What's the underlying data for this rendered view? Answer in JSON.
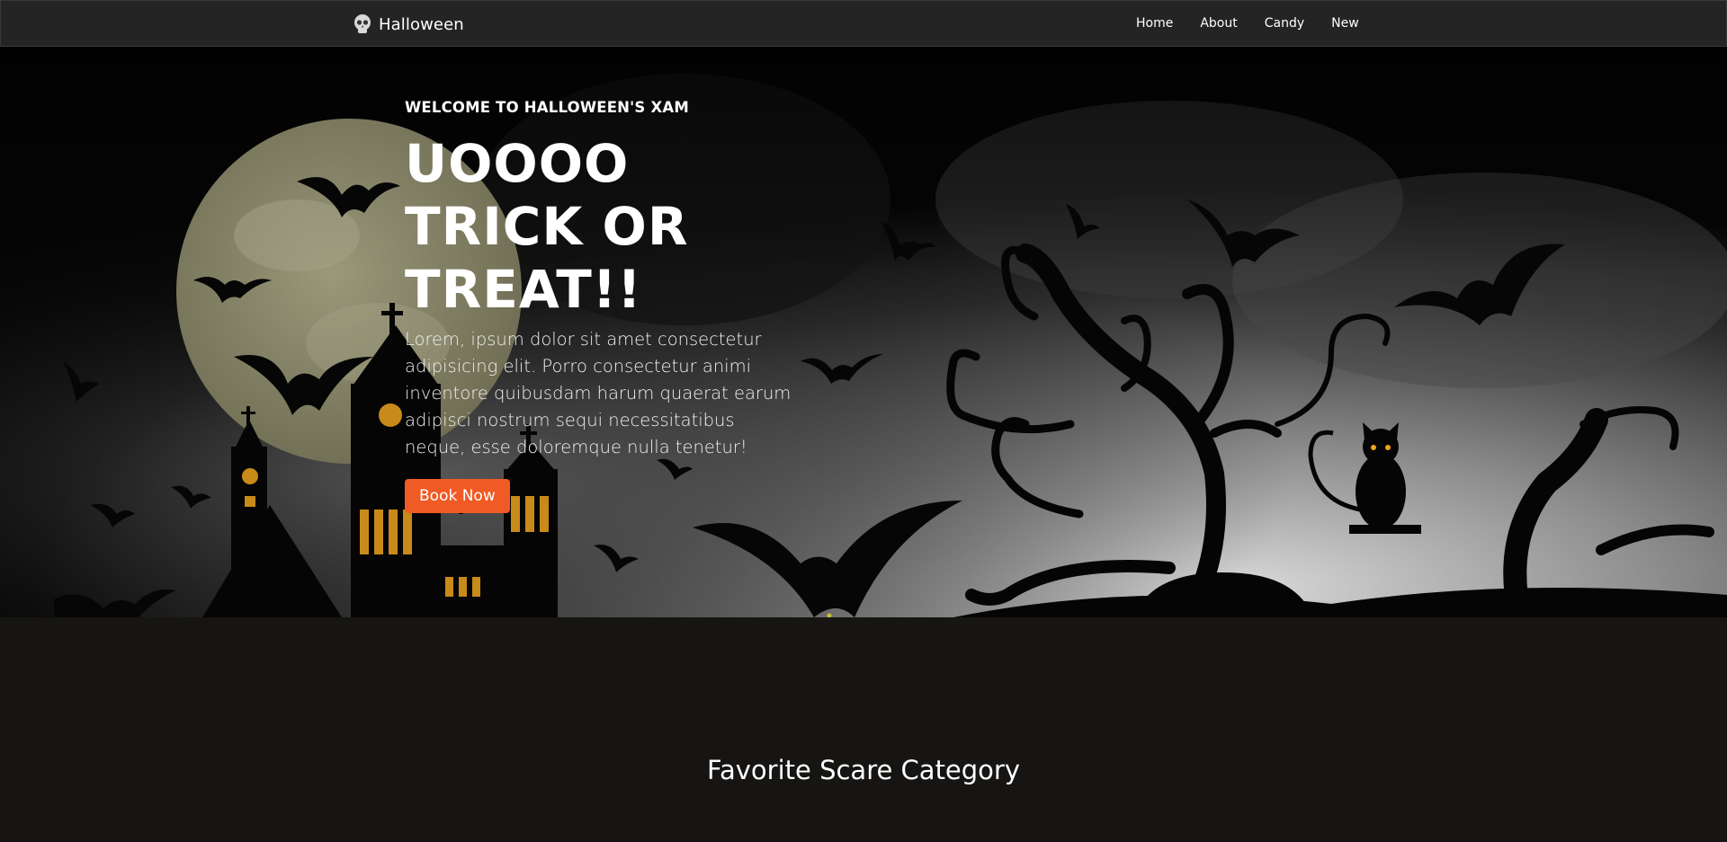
{
  "nav": {
    "brand": "Halloween",
    "links": [
      "Home",
      "About",
      "Candy",
      "New"
    ]
  },
  "hero": {
    "kicker": "WELCOME TO HALLOWEEN'S XAM",
    "headline": [
      "UOOOO",
      "TRICK OR",
      "TREAT!!"
    ],
    "lede": "Lorem, ipsum dolor sit amet consectetur adipisicing elit. Porro consectetur animi inventore quibusdam harum quaerat earum adipisci nostrum sequi necessitatibus neque, esse doloremque nulla tenetur!",
    "cta": "Book Now"
  },
  "section": {
    "title": "Favorite Scare Category"
  },
  "colors": {
    "nav_bg": "#242424",
    "page_bg": "#161513",
    "accent": "#f05a24",
    "moon": "#8a8868"
  },
  "icons": {
    "brand": "skull-icon"
  }
}
